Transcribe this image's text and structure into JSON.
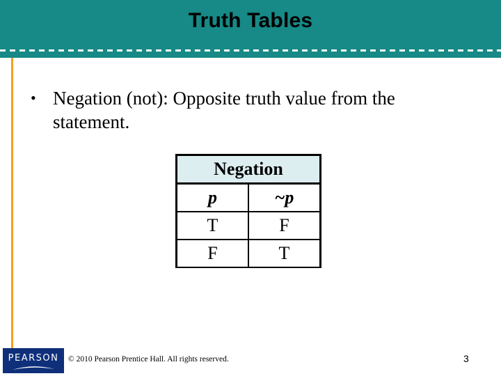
{
  "slide": {
    "title": "Truth Tables",
    "bullets": [
      {
        "marker": "•",
        "text": "Negation (not):  Opposite truth value from the statement."
      }
    ],
    "table": {
      "caption": "Negation",
      "headers": [
        "p",
        "~p"
      ],
      "rows": [
        [
          "T",
          "F"
        ],
        [
          "F",
          "T"
        ]
      ]
    },
    "footer": {
      "logo_text": "PEARSON",
      "copyright": "© 2010 Pearson Prentice Hall. All rights reserved.",
      "page_number": "3"
    }
  },
  "colors": {
    "header_band": "#178986",
    "accent_bar": "#F0A01E",
    "table_header_bg": "#DDEEF1",
    "logo_bg": "#0F2F7A"
  }
}
